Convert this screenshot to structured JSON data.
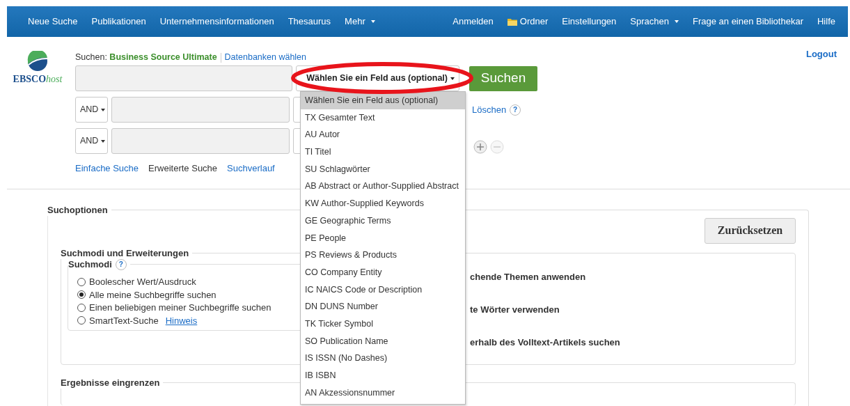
{
  "nav": {
    "left": [
      {
        "label": "Neue Suche",
        "kind": "link"
      },
      {
        "label": "Publikationen",
        "kind": "link"
      },
      {
        "label": "Unternehmensinformationen",
        "kind": "link"
      },
      {
        "label": "Thesaurus",
        "kind": "link"
      },
      {
        "label": "Mehr",
        "kind": "menu"
      }
    ],
    "right": [
      {
        "label": "Anmelden",
        "kind": "link"
      },
      {
        "label": "Ordner",
        "kind": "folder"
      },
      {
        "label": "Einstellungen",
        "kind": "link"
      },
      {
        "label": "Sprachen",
        "kind": "menu"
      },
      {
        "label": "Frage an einen Bibliothekar",
        "kind": "link"
      },
      {
        "label": "Hilfe",
        "kind": "link"
      }
    ]
  },
  "logo": {
    "brand": "EBSCO",
    "suffix": "host"
  },
  "logout": "Logout",
  "search": {
    "prefix": "Suchen:",
    "database": "Business Source Ultimate",
    "choose_db": "Datenbanken wählen",
    "button": "Suchen",
    "clear": "Löschen",
    "clear_help": "?",
    "rows": [
      {
        "field": "Wählen Sie ein Feld aus (optional)"
      },
      {
        "operator": "AND"
      },
      {
        "operator": "AND"
      }
    ],
    "modes": [
      {
        "label": "Einfache Suche",
        "selected": false
      },
      {
        "label": "Erweiterte Suche",
        "selected": true
      },
      {
        "label": "Suchverlauf",
        "selected": false
      }
    ]
  },
  "field_menu": [
    {
      "label": "Wählen Sie ein Feld aus (optional)",
      "selected": true
    },
    {
      "label": "TX Gesamter Text",
      "selected": false
    },
    {
      "label": "AU Autor",
      "selected": false
    },
    {
      "label": "TI Titel",
      "selected": false
    },
    {
      "label": "SU Schlagwörter",
      "selected": false
    },
    {
      "label": "AB Abstract or Author-Supplied Abstract",
      "selected": false
    },
    {
      "label": "KW Author-Supplied Keywords",
      "selected": false
    },
    {
      "label": "GE Geographic Terms",
      "selected": false
    },
    {
      "label": "PE People",
      "selected": false
    },
    {
      "label": "PS Reviews & Products",
      "selected": false
    },
    {
      "label": "CO Company Entity",
      "selected": false
    },
    {
      "label": "IC NAICS Code or Description",
      "selected": false
    },
    {
      "label": "DN DUNS Number",
      "selected": false
    },
    {
      "label": "TK Ticker Symbol",
      "selected": false
    },
    {
      "label": "SO Publication Name",
      "selected": false
    },
    {
      "label": "IS ISSN (No Dashes)",
      "selected": false
    },
    {
      "label": "IB ISBN",
      "selected": false
    },
    {
      "label": "AN Akzessionsnummer",
      "selected": false
    }
  ],
  "options": {
    "legend": "Suchoptionen",
    "reset": "Zurücksetzen",
    "section": {
      "legend": "Suchmodi und Erweiterungen",
      "modes_legend": "Suchmodi",
      "modes_help": "?",
      "modes": [
        {
          "label": "Boolescher Wert/Ausdruck",
          "selected": false
        },
        {
          "label": "Alle meine Suchbegriffe suchen",
          "selected": true
        },
        {
          "label": "Einen beliebigen meiner Suchbegriffe suchen",
          "selected": false
        },
        {
          "label": "SmartText-Suche",
          "selected": false,
          "hint": "Hinweis"
        }
      ],
      "expanders": [
        "chende Themen anwenden",
        "te Wörter verwenden",
        "erhalb des Volltext-Artikels suchen"
      ]
    },
    "next_legend": "Ergebnisse eingrenzen"
  }
}
